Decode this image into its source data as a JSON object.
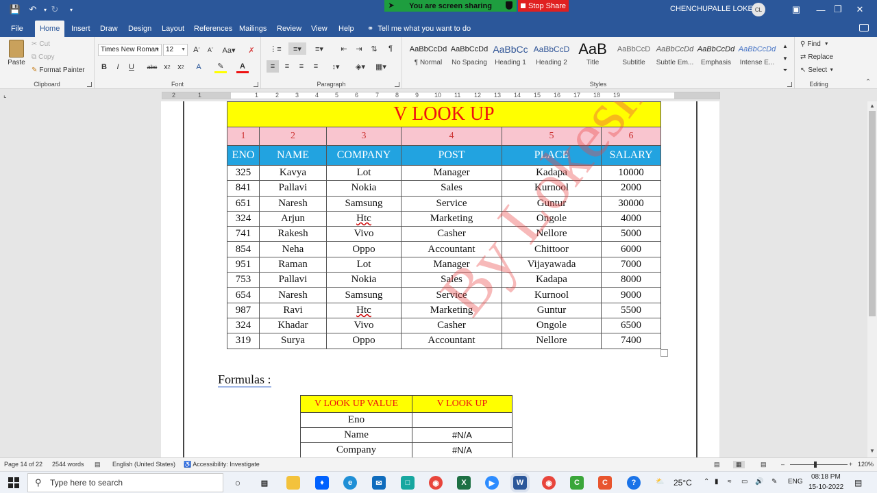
{
  "titlebar": {
    "share_status": "You are screen sharing",
    "stop_share": "Stop Share",
    "user": "CHENCHUPALLE LOKESH",
    "avatar_initials": "CL"
  },
  "menu": {
    "tabs": [
      "File",
      "Home",
      "Insert",
      "Draw",
      "Design",
      "Layout",
      "References",
      "Mailings",
      "Review",
      "View",
      "Help"
    ],
    "active_tab": "Home",
    "tell_me": "Tell me what you want to do"
  },
  "ribbon": {
    "clipboard": {
      "paste": "Paste",
      "cut": "Cut",
      "copy": "Copy",
      "format_painter": "Format Painter",
      "label": "Clipboard"
    },
    "font": {
      "family": "Times New Roman",
      "size": "12",
      "label": "Font"
    },
    "paragraph": {
      "label": "Paragraph"
    },
    "styles": {
      "label": "Styles",
      "items": [
        {
          "sample": "AaBbCcDd",
          "name": "¶ Normal"
        },
        {
          "sample": "AaBbCcDd",
          "name": "No Spacing"
        },
        {
          "sample": "AaBbCc",
          "name": "Heading 1"
        },
        {
          "sample": "AaBbCcD",
          "name": "Heading 2"
        },
        {
          "sample": "AaB",
          "name": "Title"
        },
        {
          "sample": "AaBbCcD",
          "name": "Subtitle"
        },
        {
          "sample": "AaBbCcDd",
          "name": "Subtle Em..."
        },
        {
          "sample": "AaBbCcDd",
          "name": "Emphasis"
        },
        {
          "sample": "AaBbCcDd",
          "name": "Intense E..."
        }
      ]
    },
    "editing": {
      "find": "Find",
      "replace": "Replace",
      "select": "Select",
      "label": "Editing"
    }
  },
  "ruler": {
    "numbers": [
      "2",
      "1",
      "1",
      "2",
      "3",
      "4",
      "5",
      "6",
      "7",
      "8",
      "9",
      "10",
      "11",
      "12",
      "13",
      "14",
      "15",
      "16",
      "17",
      "18",
      "19"
    ]
  },
  "document": {
    "title": "V LOOK UP",
    "col_numbers": [
      "1",
      "2",
      "3",
      "4",
      "5",
      "6"
    ],
    "headers": [
      "ENO",
      "NAME",
      "COMPANY",
      "POST",
      "PLACE",
      "SALARY"
    ],
    "rows": [
      [
        "325",
        "Kavya",
        "Lot",
        "Manager",
        "Kadapa",
        "10000"
      ],
      [
        "841",
        "Pallavi",
        "Nokia",
        "Sales",
        "Kurnool",
        "2000"
      ],
      [
        "651",
        "Naresh",
        "Samsung",
        "Service",
        "Guntur",
        "30000"
      ],
      [
        "324",
        "Arjun",
        "Htc",
        "Marketing",
        "Ongole",
        "4000"
      ],
      [
        "741",
        "Rakesh",
        "Vivo",
        "Casher",
        "Nellore",
        "5000"
      ],
      [
        "854",
        "Neha",
        "Oppo",
        "Accountant",
        "Chittoor",
        "6000"
      ],
      [
        "951",
        "Raman",
        "Lot",
        "Manager",
        "Vijayawada",
        "7000"
      ],
      [
        "753",
        "Pallavi",
        "Nokia",
        "Sales",
        "Kadapa",
        "8000"
      ],
      [
        "654",
        "Naresh",
        "Samsung",
        "Service",
        "Kurnool",
        "9000"
      ],
      [
        "987",
        "Ravi",
        "Htc",
        "Marketing",
        "Guntur",
        "5500"
      ],
      [
        "324",
        "Khadar",
        "Vivo",
        "Casher",
        "Ongole",
        "6500"
      ],
      [
        "319",
        "Surya",
        "Oppo",
        "Accountant",
        "Nellore",
        "7400"
      ]
    ],
    "formulas_label": "Formulas :",
    "formula_table": {
      "headers": [
        "V LOOK UP VALUE",
        "V LOOK UP"
      ],
      "rows": [
        [
          "Eno",
          ""
        ],
        [
          "Name",
          "#N/A"
        ],
        [
          "Company",
          "#N/A"
        ]
      ]
    },
    "watermark": "By Lokesh"
  },
  "statusbar": {
    "page": "Page 14 of 22",
    "words": "2544 words",
    "language": "English (United States)",
    "accessibility": "Accessibility: Investigate",
    "zoom": "120%"
  },
  "taskbar": {
    "search_placeholder": "Type here to search",
    "temperature": "25°C",
    "language": "ENG",
    "time": "08:18 PM",
    "date": "15-10-2022"
  },
  "colors": {
    "title_bar": "#2b579a",
    "ribbon": "#f3f3f3",
    "table_title_bg": "#ffff00",
    "table_header_bg": "#22a3e0",
    "table_number_bg": "#f9c5cf",
    "title_text": "#ee1111"
  }
}
